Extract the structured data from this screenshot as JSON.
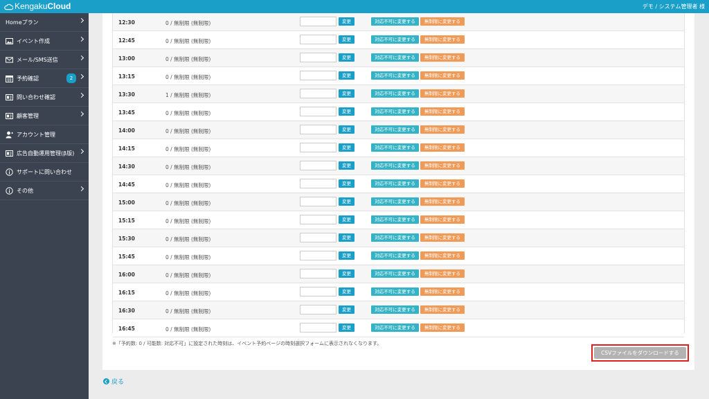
{
  "header": {
    "logo_prefix": "Kengaku",
    "logo_suffix": "Cloud",
    "user": "デモ / システム管理者 様"
  },
  "sidebar": {
    "items": [
      {
        "label": "Homeプラン",
        "icon": "none",
        "chevron": true
      },
      {
        "label": "イベント作成",
        "icon": "image-icon",
        "chevron": true
      },
      {
        "label": "メール/SMS送信",
        "icon": "mail-icon",
        "chevron": true
      },
      {
        "label": "予約確認",
        "icon": "calendar-icon",
        "chevron": true,
        "badge": "2"
      },
      {
        "label": "問い合わせ確認",
        "icon": "id-card-icon",
        "chevron": true
      },
      {
        "label": "顧客管理",
        "icon": "id-card-icon",
        "chevron": true
      },
      {
        "label": "アカウント管理",
        "icon": "user-icon",
        "chevron": false
      },
      {
        "label": "広告自動運用管理(β版)",
        "icon": "id-card-icon",
        "chevron": true
      },
      {
        "label": "サポートに問い合わせ",
        "icon": "info-icon",
        "chevron": false
      },
      {
        "label": "その他",
        "icon": "info-icon",
        "chevron": true
      }
    ]
  },
  "table": {
    "change_label": "変更",
    "not_available_label": "対応不可に変更する",
    "unlimited_label": "無制限に変更する",
    "rows": [
      {
        "time": "12:30",
        "count": "0 / 無制限 (無制限)"
      },
      {
        "time": "12:45",
        "count": "0 / 無制限 (無制限)"
      },
      {
        "time": "13:00",
        "count": "0 / 無制限 (無制限)"
      },
      {
        "time": "13:15",
        "count": "0 / 無制限 (無制限)"
      },
      {
        "time": "13:30",
        "count": "1 / 無制限 (無制限)"
      },
      {
        "time": "13:45",
        "count": "0 / 無制限 (無制限)"
      },
      {
        "time": "14:00",
        "count": "0 / 無制限 (無制限)"
      },
      {
        "time": "14:15",
        "count": "0 / 無制限 (無制限)"
      },
      {
        "time": "14:30",
        "count": "0 / 無制限 (無制限)"
      },
      {
        "time": "14:45",
        "count": "0 / 無制限 (無制限)"
      },
      {
        "time": "15:00",
        "count": "0 / 無制限 (無制限)"
      },
      {
        "time": "15:15",
        "count": "0 / 無制限 (無制限)"
      },
      {
        "time": "15:30",
        "count": "0 / 無制限 (無制限)"
      },
      {
        "time": "15:45",
        "count": "0 / 無制限 (無制限)"
      },
      {
        "time": "16:00",
        "count": "0 / 無制限 (無制限)"
      },
      {
        "time": "16:15",
        "count": "0 / 無制限 (無制限)"
      },
      {
        "time": "16:30",
        "count": "0 / 無制限 (無制限)"
      },
      {
        "time": "16:45",
        "count": "0 / 無制限 (無制限)"
      }
    ]
  },
  "note": "※「予約数: 0 / 可能数: 対応不可」に設定された時刻は、イベント予約ページの時刻選択フォームに表示されなくなります。",
  "csv_button": "CSVファイルをダウンロードする",
  "back_link": "戻る",
  "colors": {
    "brand": "#1a9fc9",
    "sidebar": "#3b4351",
    "not_available": "#35b3c6",
    "unlimited": "#ef9a57",
    "highlight": "#e02020"
  }
}
